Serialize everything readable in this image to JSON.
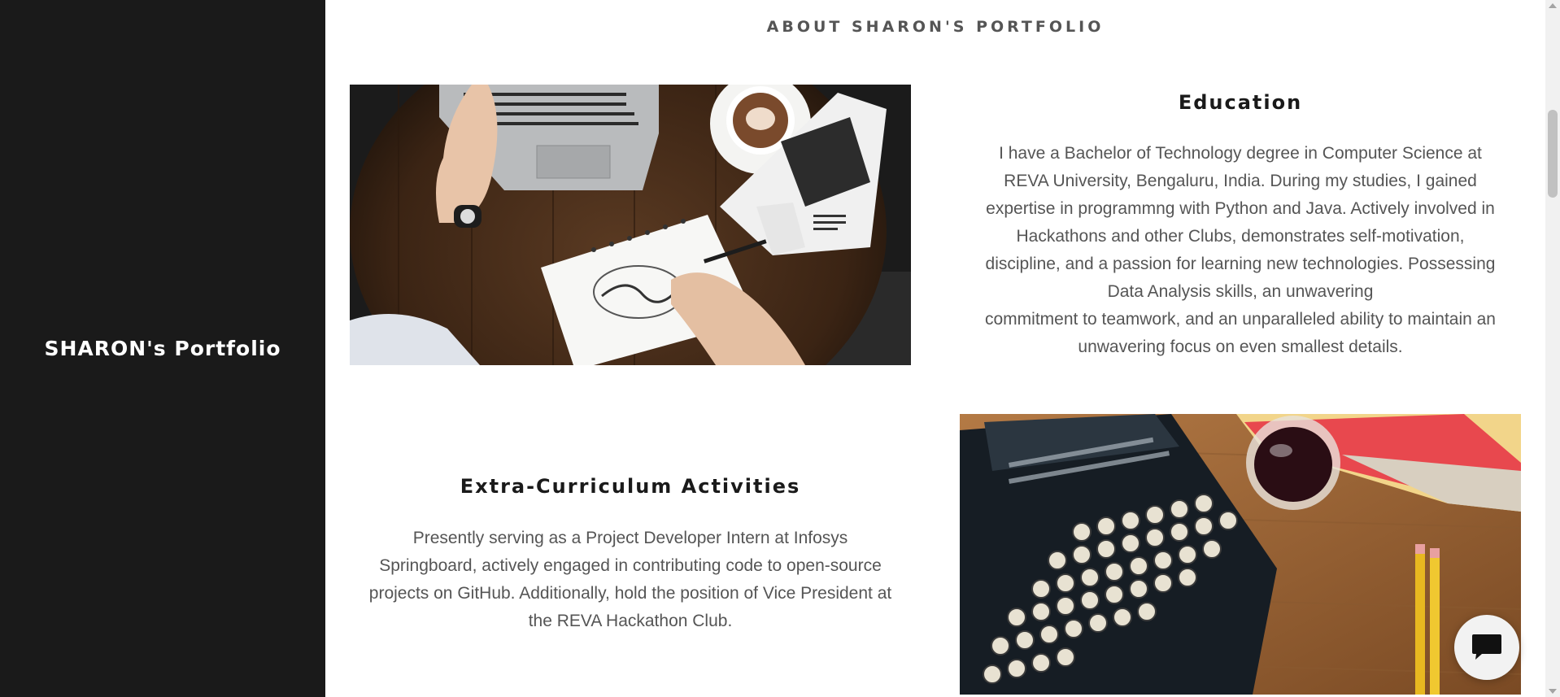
{
  "sidebar": {
    "site_title": "SHARON's Portfolio"
  },
  "main": {
    "section_heading": "ABOUT SHARON'S PORTFOLIO",
    "education": {
      "title": "Education",
      "lines": [
        "I have a  Bachelor of Technology degree in Computer Science at",
        "REVA University, Bengaluru, India. During my studies, I gained",
        "expertise in programmng with Python and Java. Actively involved in",
        "Hackathons and other Clubs, demonstrates self-motivation,",
        "discipline, and a passion for learning new technologies. Possessing",
        "Data Analysis skills, an unwavering",
        "commitment to teamwork, and an unparalleled ability to maintain an",
        "unwavering focus on even smallest details."
      ]
    },
    "extra": {
      "title": "Extra-Curriculum Activities",
      "lines": [
        "Presently serving as a Project Developer Intern at Infosys",
        "Springboard, actively engaged in contributing code to open-source",
        "projects on GitHub. Additionally, hold the position of Vice President at",
        "the REVA Hackathon Club."
      ]
    }
  },
  "icons": {
    "chat": "chat-bubble-icon"
  },
  "colors": {
    "sidebar_bg": "#1a1a1a",
    "heading_text": "#555555",
    "body_text": "#555555"
  }
}
